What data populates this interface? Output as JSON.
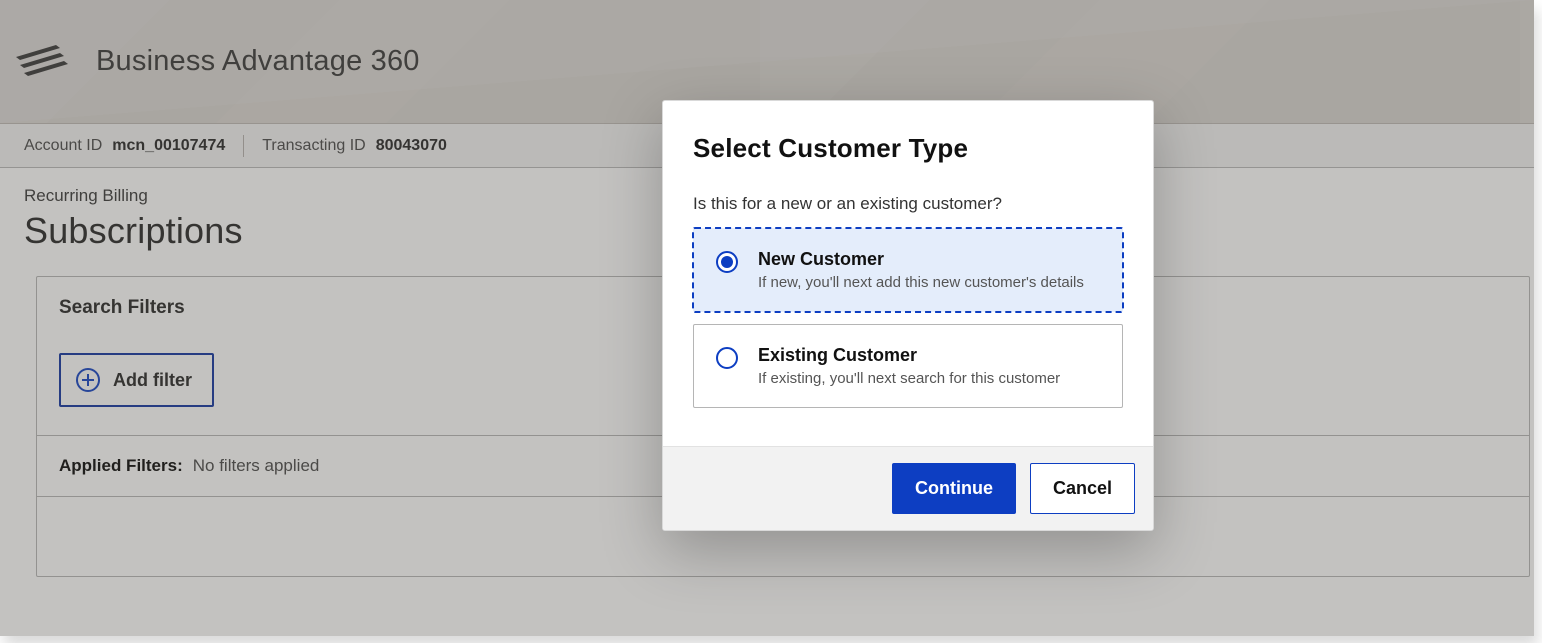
{
  "header": {
    "product_name": "Business Advantage 360"
  },
  "account_bar": {
    "account_id_label": "Account ID",
    "account_id_value": "mcn_00107474",
    "transacting_id_label": "Transacting ID",
    "transacting_id_value": "80043070"
  },
  "main": {
    "breadcrumb": "Recurring Billing",
    "page_title": "Subscriptions",
    "search_filters_header": "Search Filters",
    "add_filter_label": "Add filter",
    "applied_filters_label": "Applied Filters:",
    "applied_filters_value": "No filters applied"
  },
  "modal": {
    "title": "Select Customer Type",
    "question": "Is this for a new or an existing customer?",
    "options": [
      {
        "title": "New Customer",
        "subtitle": "If new, you'll next add this new customer's details",
        "selected": true
      },
      {
        "title": "Existing Customer",
        "subtitle": "If existing, you'll next search for this customer",
        "selected": false
      }
    ],
    "continue_label": "Continue",
    "cancel_label": "Cancel"
  }
}
